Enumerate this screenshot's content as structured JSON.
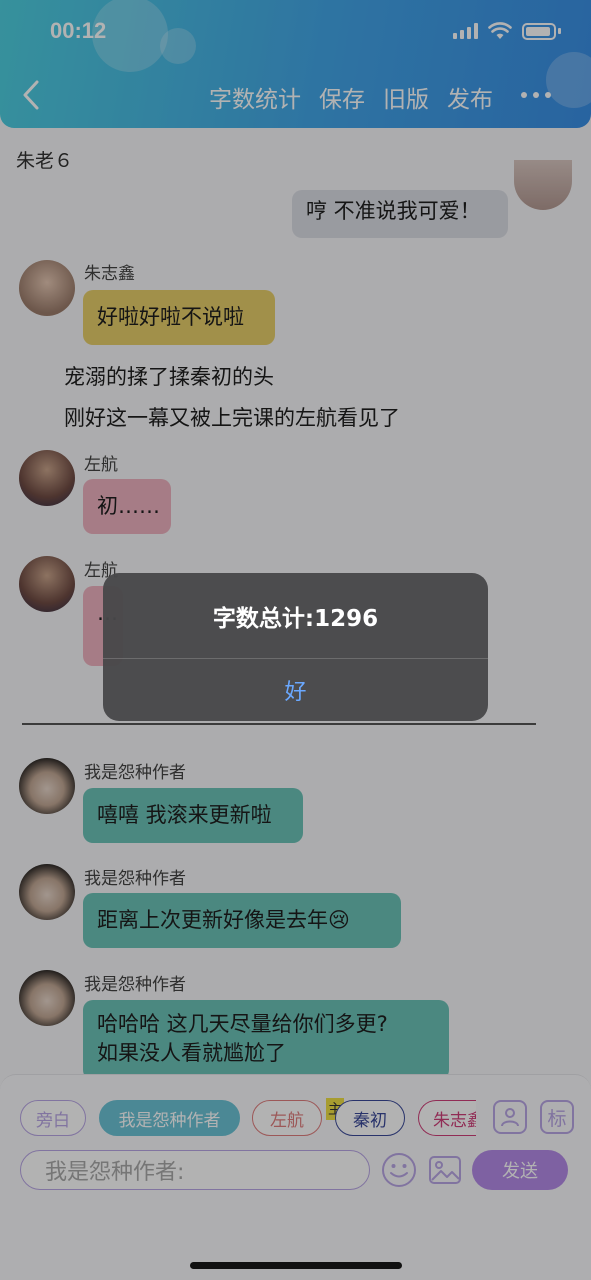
{
  "status": {
    "time": "00:12"
  },
  "nav": {
    "items": [
      "字数统计",
      "保存",
      "旧版",
      "发布"
    ]
  },
  "chat_title": "朱老６",
  "messages": [
    {
      "kind": "self",
      "text": "哼 不准说我可爱！"
    },
    {
      "kind": "other",
      "sender": "朱志鑫",
      "text": "好啦好啦不说啦",
      "color": "#e7ce6a"
    },
    {
      "kind": "narration",
      "text": "宠溺的揉了揉秦初的头"
    },
    {
      "kind": "narration",
      "text": "刚好这一幕又被上完课的左航看见了"
    },
    {
      "kind": "other",
      "sender": "左航",
      "text": "初……",
      "color": "#eeb2c0"
    },
    {
      "kind": "other",
      "sender": "左航",
      "text": "…",
      "color": "#eeb2c0"
    },
    {
      "kind": "other",
      "sender": "我是怨种作者",
      "text": "嘻嘻 我滚来更新啦",
      "color": "#6cc3b8"
    },
    {
      "kind": "other",
      "sender": "我是怨种作者",
      "text": "距离上次更新好像是去年😢",
      "color": "#6cc3b8"
    },
    {
      "kind": "other",
      "sender": "我是怨种作者",
      "text": "哈哈哈 这几天尽量给你们多更?\n如果没人看就尴尬了",
      "color": "#6cc3b8"
    }
  ],
  "roles": [
    {
      "label": "旁白",
      "color": "#b9a6e6",
      "active": false
    },
    {
      "label": "我是怨种作者",
      "color": "#6cc3d6",
      "active": true
    },
    {
      "label": "左航",
      "color": "#e07e7e",
      "active": false
    },
    {
      "label": "秦初",
      "color": "#3b4a9a",
      "active": false
    },
    {
      "label": "朱志鑫",
      "color": "#d0407a",
      "active": false
    }
  ],
  "main_tag": "主",
  "mark_button": "标",
  "input": {
    "placeholder": "我是怨种作者:"
  },
  "send_label": "发送",
  "alert": {
    "title": "字数总计:1296",
    "button": "好"
  }
}
